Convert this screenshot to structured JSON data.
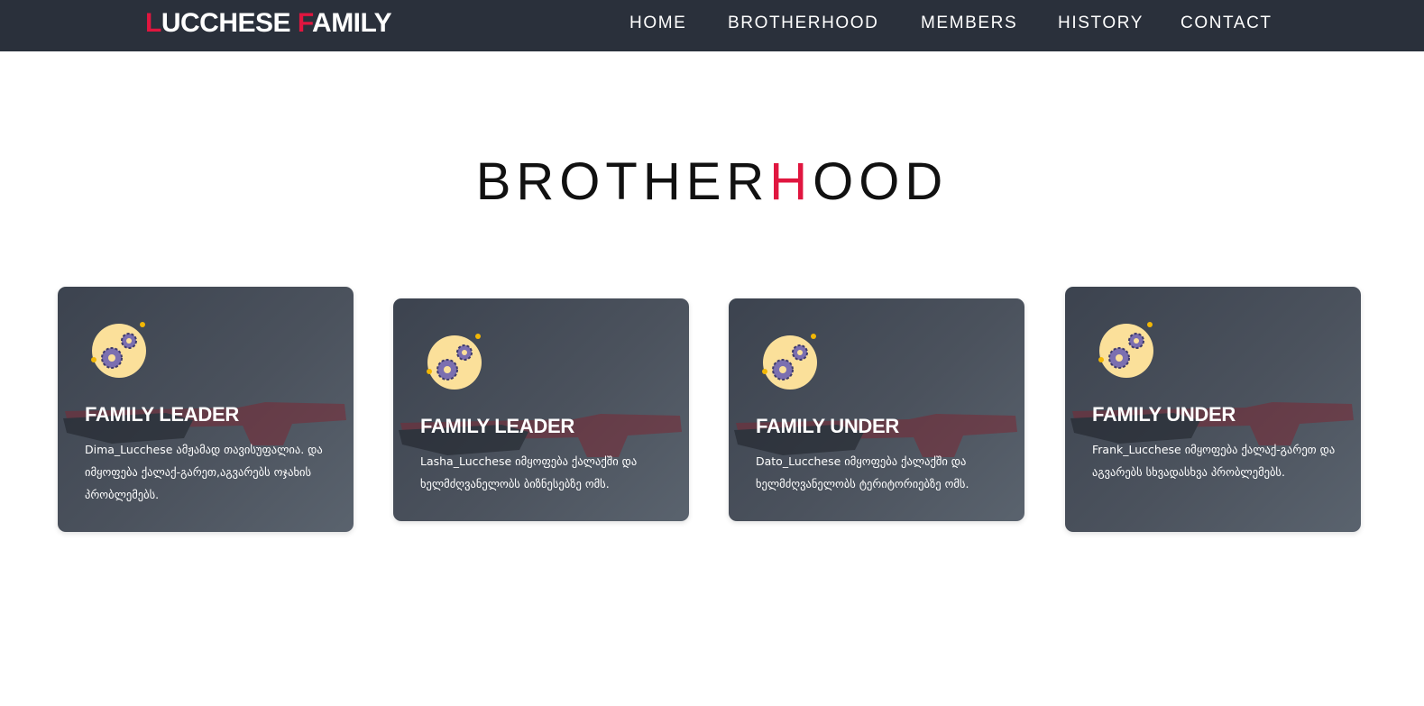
{
  "header": {
    "logo_first_initial": "L",
    "logo_first_rest": "UCCHESE ",
    "logo_second_initial": "F",
    "logo_second_rest": "AMILY",
    "nav": [
      {
        "label": "HOME"
      },
      {
        "label": "BROTHERHOOD"
      },
      {
        "label": "MEMBERS"
      },
      {
        "label": "HISTORY"
      },
      {
        "label": "CONTACT"
      }
    ]
  },
  "section": {
    "title_before": "BROTHER",
    "title_accent": "H",
    "title_after": "OOD"
  },
  "cards": [
    {
      "title": "FAMILY LEADER",
      "text": "Dima_Lucchese ამჟამად თავისუფალია. და იმყოფება ქალაქ-გარეთ,აგვარებს ოჯახის პრობლემებს.",
      "icon": "gears-icon"
    },
    {
      "title": "FAMILY LEADER",
      "text": "Lasha_Lucchese იმყოფება ქალაქში და ხელმძღვანელობს ბიზნესებზე ომს.",
      "icon": "gears-icon"
    },
    {
      "title": "FAMILY UNDER",
      "text": "Dato_Lucchese იმყოფება ქალაქში და ხელმძღვანელობს ტერიტორიებზე ომს.",
      "icon": "gears-icon"
    },
    {
      "title": "FAMILY UNDER",
      "text": "Frank_Lucchese იმყოფება ქალაქ-გარეთ და აგვარებს სხვადასხვა პრობლემებს.",
      "icon": "gears-icon"
    }
  ],
  "colors": {
    "navbar": "#2a303b",
    "accent": "#e0163f",
    "card": "#4b525d",
    "icon_circle": "#fbe09a",
    "gear": "#7b6fb0"
  }
}
